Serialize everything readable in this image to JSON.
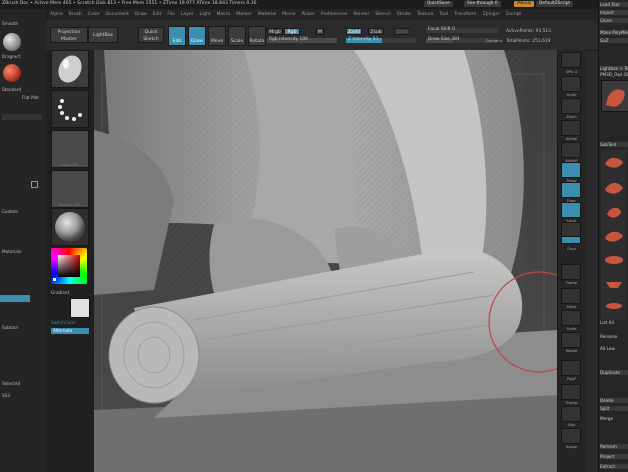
{
  "titlebar": {
    "text": "ZBrush Doc  • Active Mem 465  • Scratch Disk 813  • Free Mem 1551  • ZTime 19.977  ATime 18.843  Timers 0.36",
    "quicksave": "QuickSave",
    "see_through": "See-through 0",
    "menus": "Menus",
    "default_script": "DefaultZScript"
  },
  "menubar": [
    "Alpha",
    "Brush",
    "Color",
    "Document",
    "Draw",
    "Edit",
    "File",
    "Layer",
    "Light",
    "Macro",
    "Marker",
    "Material",
    "Movie",
    "Picker",
    "Preferences",
    "Render",
    "Stencil",
    "Stroke",
    "Texture",
    "Tool",
    "Transform",
    "Zplugin",
    "Zscript"
  ],
  "shelf": {
    "projection_master": "Projection Master",
    "lightbox": "LightBox",
    "quick_sketch": "Quick Sketch",
    "edit": "Edit",
    "draw": "Draw",
    "move": "Move",
    "scale": "Scale",
    "rotate": "Rotate",
    "mrgb": "Mrgb",
    "rgb": "Rgb",
    "m": "M",
    "zadd": "Zadd",
    "zsub": "Zsub",
    "zcut": "Zcut",
    "rgb_intensity": "Rgb Intensity 100",
    "z_intensity": "Z Intensity 51",
    "focal_shift": "Focal Shift 0",
    "draw_size": "Draw Size 384",
    "dynamic": "Dynamic",
    "active_points": "ActivePoints: 93,513",
    "total_points": "TotalPoints: 251,619"
  },
  "tray": {
    "labels": [
      "",
      "Standard",
      "Dots",
      "Alpha Off",
      "Texture Off",
      "MatCap Gray"
    ],
    "gradient": "Gradient",
    "switch_color": "SwitchColor",
    "alternate": "Alternate"
  },
  "leftpanel": [
    "Smooth",
    "Dragrect",
    "Standard",
    "Flat Mat",
    "Custom",
    "Materials",
    "Subtool",
    "Selected",
    "SS3"
  ],
  "rightshelf": [
    "SPix 3",
    "Scroll",
    "Zoom",
    "Actual",
    "AAHalf",
    "Persp",
    "Floor",
    "Local",
    "L.Sym",
    "Gxyz",
    "Frame",
    "Move",
    "Scale",
    "Rotate",
    "Line Fill",
    "PolyF",
    "Transp",
    "Solo",
    "Xpose"
  ],
  "rightpanel": {
    "items": [
      "Load Tool",
      "Import",
      "Clone",
      "Make PolyMesh3D",
      "GoZ",
      "All",
      "Visible",
      "R",
      "Lightbox > Tools",
      "PM3D_Owl 42",
      "SubTool",
      "List All",
      "Rename",
      "AutoReorder",
      "All Low",
      "Duplicate",
      "Append",
      "Insert",
      "Delete",
      "Del Other",
      "Split",
      "Merge",
      "MergeDown",
      "MergeVisible",
      "Remesh",
      "Project",
      "Extract"
    ],
    "accent": "#3a8fb0"
  },
  "colors": {
    "active": "#3a8fb0",
    "orange": "#c98a2a",
    "cursor_ring": "#c2453f"
  }
}
